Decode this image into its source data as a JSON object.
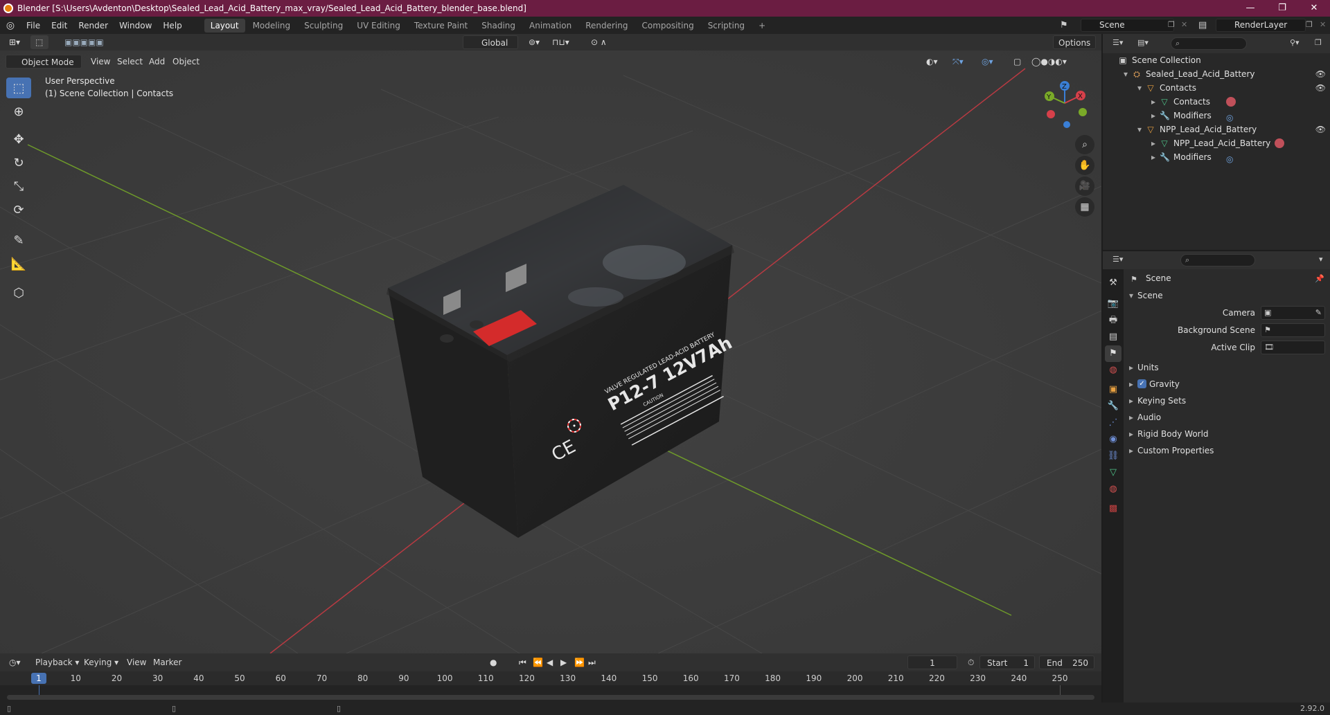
{
  "window": {
    "title": "Blender [S:\\Users\\Avdenton\\Desktop\\Sealed_Lead_Acid_Battery_max_vray/Sealed_Lead_Acid_Battery_blender_base.blend]",
    "controls": [
      "—",
      "❐",
      "✕"
    ]
  },
  "menu": [
    "File",
    "Edit",
    "Render",
    "Window",
    "Help"
  ],
  "workspaces": [
    {
      "label": "Layout",
      "active": true
    },
    {
      "label": "Modeling"
    },
    {
      "label": "Sculpting"
    },
    {
      "label": "UV Editing"
    },
    {
      "label": "Texture Paint"
    },
    {
      "label": "Shading"
    },
    {
      "label": "Animation"
    },
    {
      "label": "Rendering"
    },
    {
      "label": "Compositing"
    },
    {
      "label": "Scripting"
    }
  ],
  "add_workspace": "+",
  "scene_field": "Scene",
  "view_layer_field": "RenderLayer",
  "viewport": {
    "transform_orientation": "Global",
    "options_label": "Options",
    "mode": "Object Mode",
    "menus": [
      "View",
      "Select",
      "Add",
      "Object"
    ],
    "overlay_text_1": "User Perspective",
    "overlay_text_2": "(1) Scene Collection | Contacts",
    "gizmo_axes": {
      "x": "X",
      "y": "Y",
      "z": "Z"
    },
    "battery_label": {
      "line1": "VALVE REGULATED LEAD-ACID BATTERY",
      "model": "P12-7 12V7Ah",
      "caution": "CAUTION",
      "ce": "CE"
    },
    "accent_color": "#4772b3",
    "axis_x_color": "#b83a42",
    "axis_y_color": "#6e9a2a"
  },
  "tools": [
    "select-box",
    "cursor",
    "move",
    "rotate",
    "scale",
    "transform",
    "annotate",
    "measure",
    "add-cube"
  ],
  "outliner": {
    "root": "Scene Collection",
    "rows": [
      {
        "label": "Sealed_Lead_Acid_Battery",
        "indent": 1,
        "icon": "collection"
      },
      {
        "label": "Contacts",
        "indent": 2,
        "icon": "object"
      },
      {
        "label": "Contacts",
        "indent": 3,
        "icon": "mesh"
      },
      {
        "label": "Modifiers",
        "indent": 3,
        "icon": "wrench"
      },
      {
        "label": "NPP_Lead_Acid_Battery",
        "indent": 2,
        "icon": "object"
      },
      {
        "label": "NPP_Lead_Acid_Battery",
        "indent": 3,
        "icon": "mesh"
      },
      {
        "label": "Modifiers",
        "indent": 3,
        "icon": "wrench"
      }
    ]
  },
  "properties": {
    "context": "Scene",
    "section": "Scene",
    "fields": [
      {
        "label": "Camera",
        "value": ""
      },
      {
        "label": "Background Scene",
        "value": ""
      },
      {
        "label": "Active Clip",
        "value": ""
      }
    ],
    "panels": [
      "Units",
      "Gravity",
      "Keying Sets",
      "Audio",
      "Rigid Body World",
      "Custom Properties"
    ],
    "gravity_checked": true
  },
  "timeline": {
    "menus": [
      "Playback",
      "Keying",
      "View",
      "Marker"
    ],
    "current_frame": "1",
    "start_label": "Start",
    "start": "1",
    "end_label": "End",
    "end": "250",
    "ticks": [
      "10",
      "20",
      "30",
      "40",
      "50",
      "60",
      "70",
      "80",
      "90",
      "100",
      "110",
      "120",
      "130",
      "140",
      "150",
      "160",
      "170",
      "180",
      "190",
      "200",
      "210",
      "220",
      "230",
      "240",
      "250"
    ],
    "playhead": "1"
  },
  "status": {
    "version": "2.92.0"
  }
}
